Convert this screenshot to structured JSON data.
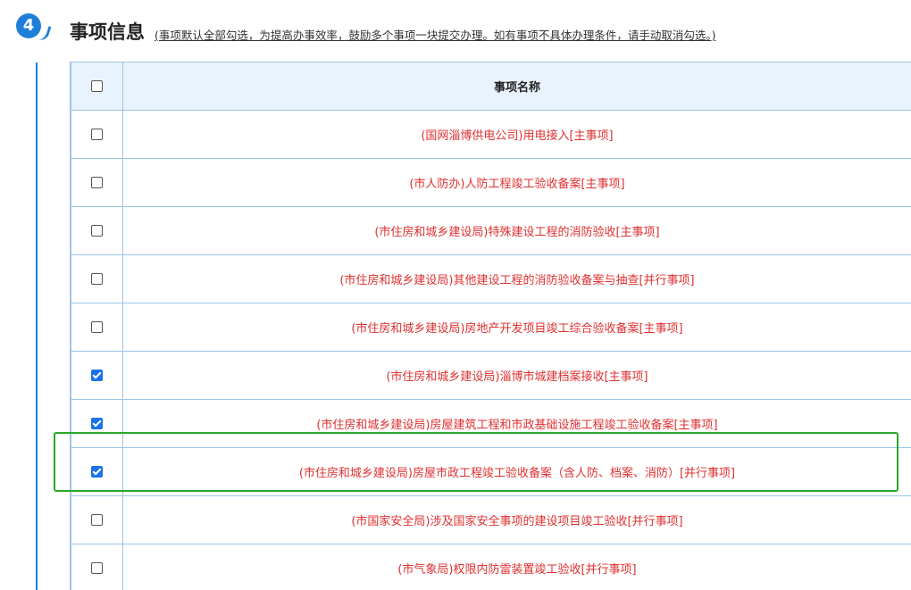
{
  "section": {
    "step_number": "4",
    "title": "事项信息",
    "note": "(事项默认全部勾选，为提高办事效率，鼓励多个事项一块提交办理。如有事项不具体办理条件，请手动取消勾选。)"
  },
  "table": {
    "header_name": "事项名称",
    "header_checked": false,
    "rows": [
      {
        "name": "(国网淄博供电公司)用电接入[主事项]",
        "checked": false
      },
      {
        "name": "(市人防办)人防工程竣工验收备案[主事项]",
        "checked": false
      },
      {
        "name": "(市住房和城乡建设局)特殊建设工程的消防验收[主事项]",
        "checked": false
      },
      {
        "name": "(市住房和城乡建设局)其他建设工程的消防验收备案与抽查[并行事项]",
        "checked": false
      },
      {
        "name": "(市住房和城乡建设局)房地产开发项目竣工综合验收备案[主事项]",
        "checked": false
      },
      {
        "name": "(市住房和城乡建设局)淄博市城建档案接收[主事项]",
        "checked": true
      },
      {
        "name": "(市住房和城乡建设局)房屋建筑工程和市政基础设施工程竣工验收备案[主事项]",
        "checked": true
      },
      {
        "name": "(市住房和城乡建设局)房屋市政工程竣工验收备案（含人防、档案、消防）[并行事项]",
        "checked": true
      },
      {
        "name": "(市国家安全局)涉及国家安全事项的建设项目竣工验收[并行事项]",
        "checked": false
      },
      {
        "name": "(市气象局)权限内防雷装置竣工验收[并行事项]",
        "checked": false
      }
    ]
  },
  "colors": {
    "accent": "#1f7fd8",
    "item_text": "#e03030",
    "highlight": "#28a828",
    "check": "#1a73e8"
  }
}
